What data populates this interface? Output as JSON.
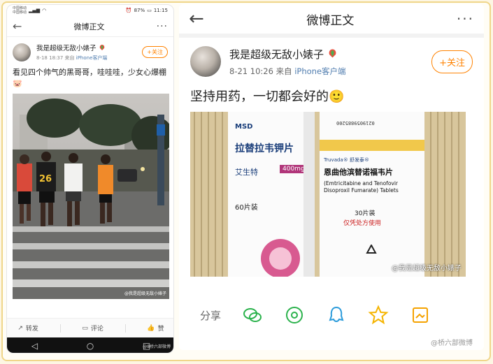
{
  "left": {
    "status": {
      "carrier1": "中国移动",
      "carrier2": "中国移动",
      "battery": "87%",
      "time": "11:15"
    },
    "nav": {
      "title": "微博正文",
      "more": "···"
    },
    "post": {
      "author": "我是超级无敌小婊子",
      "date": "8-18 18:37",
      "from_prefix": "来自",
      "source": "iPhone客户端",
      "follow": "+关注",
      "text": "看见四个帅气的黑哥哥，哇哇哇，少女心爆棚🐷",
      "jersey_number": "26",
      "watermark": "@我是超级无敌小婊子"
    },
    "actions": {
      "repost": "转发",
      "comment": "评论",
      "like": "赞"
    },
    "android_watermark": "@8桥六部微博"
  },
  "right": {
    "nav": {
      "title": "微博正文",
      "more": "···"
    },
    "post": {
      "author": "我是超级无敌小婊子",
      "date": "8-21 10:26",
      "from_prefix": "来自",
      "source": "iPhone客户端",
      "follow": "+关注",
      "text": "坚持用药，一切都会好的🙂",
      "watermark": "@我是超级无敌小婊子"
    },
    "box1": {
      "maker": "MSD",
      "drug": "拉替拉韦钾片",
      "brand": "艾生特",
      "dose": "400mg",
      "count": "60片装"
    },
    "box2": {
      "barcode": "0219059885200",
      "brand": "Truvada® 舒发泰®",
      "drug": "恩曲他滨替诺福韦片",
      "english": "(Emtricitabine and Tenofovir Disoproxil Fumarate) Tablets",
      "count": "30片装",
      "rx": "仅凭处方使用"
    },
    "share_label": "分享",
    "bottom_watermark": "@桥六部微博"
  }
}
